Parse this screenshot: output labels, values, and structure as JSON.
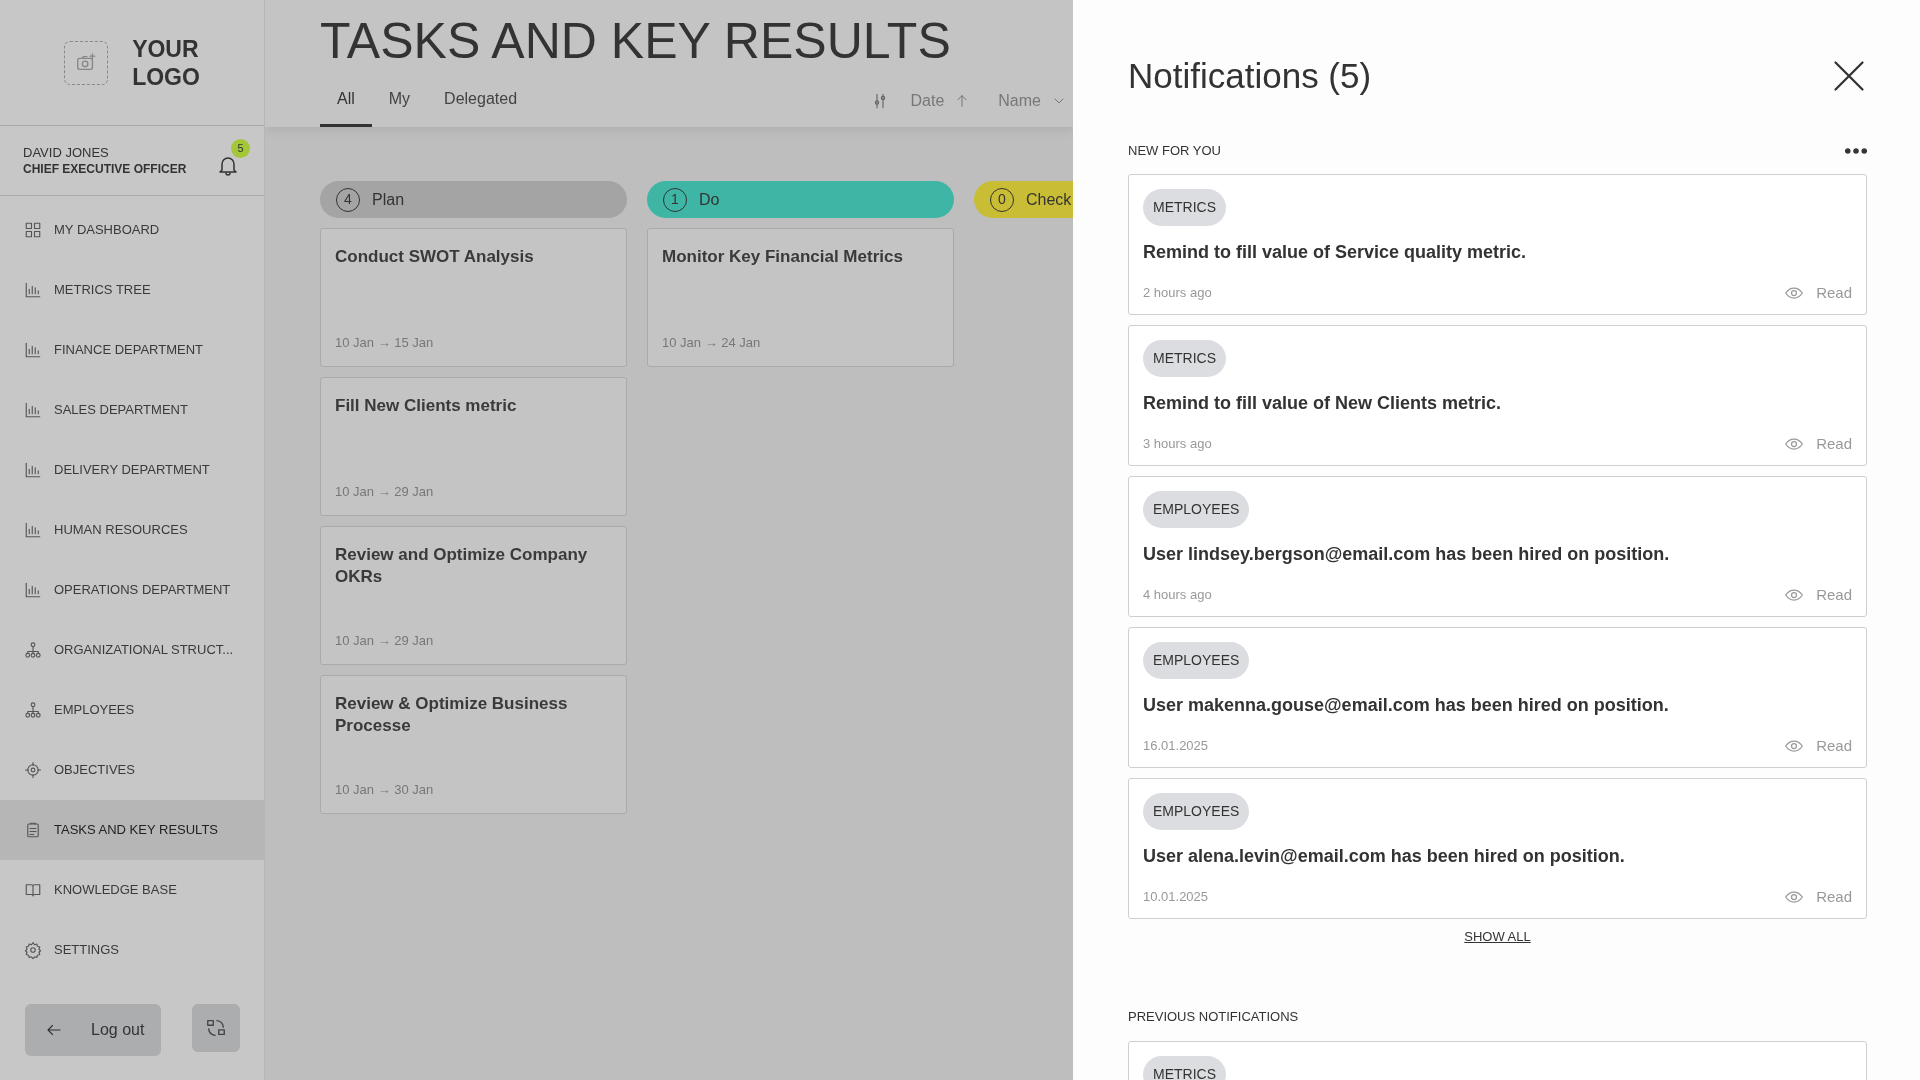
{
  "logo": {
    "line_1": "YOUR",
    "line_2": "LOGO"
  },
  "user": {
    "name": "DAVID JONES",
    "role": "CHIEF EXECUTIVE OFFICER",
    "notification_count": "5"
  },
  "sidebar": {
    "items": [
      {
        "label": "MY DASHBOARD",
        "kind": "grid",
        "selected": false
      },
      {
        "label": "METRICS TREE",
        "kind": "chart",
        "selected": false
      },
      {
        "label": "FINANCE DEPARTMENT",
        "kind": "chart",
        "selected": false
      },
      {
        "label": "SALES DEPARTMENT",
        "kind": "chart",
        "selected": false
      },
      {
        "label": "DELIVERY DEPARTMENT",
        "kind": "chart",
        "selected": false
      },
      {
        "label": "HUMAN RESOURCES",
        "kind": "chart",
        "selected": false
      },
      {
        "label": "OPERATIONS DEPARTMENT",
        "kind": "chart",
        "selected": false
      },
      {
        "label": "ORGANIZATIONAL STRUCT...",
        "kind": "org",
        "selected": false
      },
      {
        "label": "EMPLOYEES",
        "kind": "org",
        "selected": false
      },
      {
        "label": "OBJECTIVES",
        "kind": "target",
        "selected": false
      },
      {
        "label": "TASKS AND KEY RESULTS",
        "kind": "clipboard",
        "selected": true
      },
      {
        "label": "KNOWLEDGE BASE",
        "kind": "book",
        "selected": false
      },
      {
        "label": "SETTINGS",
        "kind": "gear",
        "selected": false
      }
    ],
    "logout": "Log out"
  },
  "page": {
    "title": "TASKS AND KEY RESULTS",
    "tabs": [
      {
        "label": "All",
        "selected": true
      },
      {
        "label": "My",
        "selected": false
      },
      {
        "label": "Delegated",
        "selected": false
      }
    ],
    "sort": [
      {
        "label": "Date",
        "kind": "up"
      },
      {
        "label": "Name",
        "kind": "down"
      }
    ]
  },
  "board": {
    "columns": [
      {
        "name": "Plan",
        "count": "4",
        "color": "#a3a4a3",
        "cards": [
          {
            "title": "Conduct SWOT Analysis",
            "dates": "10 Jan → 15 Jan"
          },
          {
            "title": "Fill New Clients metric",
            "dates": "10 Jan → 29 Jan"
          },
          {
            "title": "Review and Optimize Company OKRs",
            "dates": "10 Jan → 29 Jan"
          },
          {
            "title": "Review & Optimize Business Processe",
            "dates": "10 Jan → 30 Jan"
          }
        ]
      },
      {
        "name": "Do",
        "count": "1",
        "color": "#3fb5a6",
        "cards": [
          {
            "title": "Monitor Key Financial Metrics",
            "dates": "10 Jan → 24 Jan"
          }
        ]
      },
      {
        "name": "Check",
        "count": "0",
        "color": "#c9bd35"
      }
    ]
  },
  "notifications": {
    "title": "Notifications (5)",
    "new_heading": "NEW FOR YOU",
    "new_items": [
      {
        "tag": "METRICS",
        "message": "Remind to fill value of Service quality metric.",
        "time": "2 hours ago",
        "action": "Read"
      },
      {
        "tag": "METRICS",
        "message": "Remind to fill value of New Clients metric.",
        "time": "3 hours ago",
        "action": "Read"
      },
      {
        "tag": "EMPLOYEES",
        "message": "User lindsey.bergson@email.com has been hired on position.",
        "time": "4 hours ago",
        "action": "Read"
      },
      {
        "tag": "EMPLOYEES",
        "message": "User makenna.gouse@email.com has been hired on position.",
        "time": "16.01.2025",
        "action": "Read"
      },
      {
        "tag": "EMPLOYEES",
        "message": "User alena.levin@email.com has been hired on position.",
        "time": "10.01.2025",
        "action": "Read"
      }
    ],
    "show_all": "SHOW ALL",
    "previous_heading": "PREVIOUS NOTIFICATIONS",
    "previous_items": [
      {
        "tag": "METRICS"
      }
    ]
  }
}
